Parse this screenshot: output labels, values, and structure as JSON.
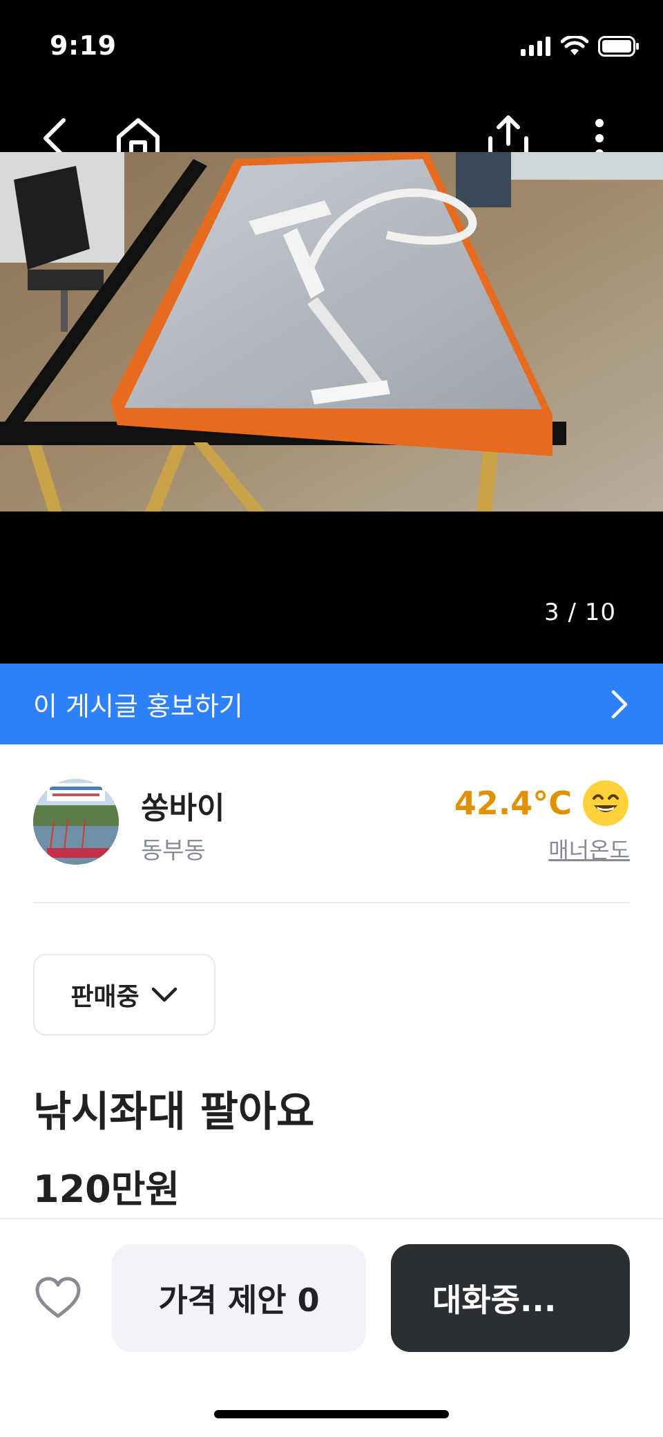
{
  "status_bar": {
    "time": "9:19"
  },
  "media": {
    "counter": "3 / 10",
    "icons": [
      "back-icon",
      "home-icon",
      "share-icon",
      "more-icon"
    ]
  },
  "promo": {
    "label": "이 게시글 홍보하기"
  },
  "seller": {
    "name": "쏭바이",
    "location": "동부동",
    "temperature": "42.4°C",
    "temperature_label": "매너온도",
    "temperature_color": "#df9100"
  },
  "listing": {
    "status": "판매중",
    "title": "낚시좌대 팔아요",
    "price": "120만원"
  },
  "actions": {
    "offer_label": "가격 제안 0",
    "chat_label": "대화중..."
  },
  "colors": {
    "promo_bg": "#2f80fb",
    "chat_bg": "#2b2e33",
    "offer_bg": "#f2f3f6"
  }
}
